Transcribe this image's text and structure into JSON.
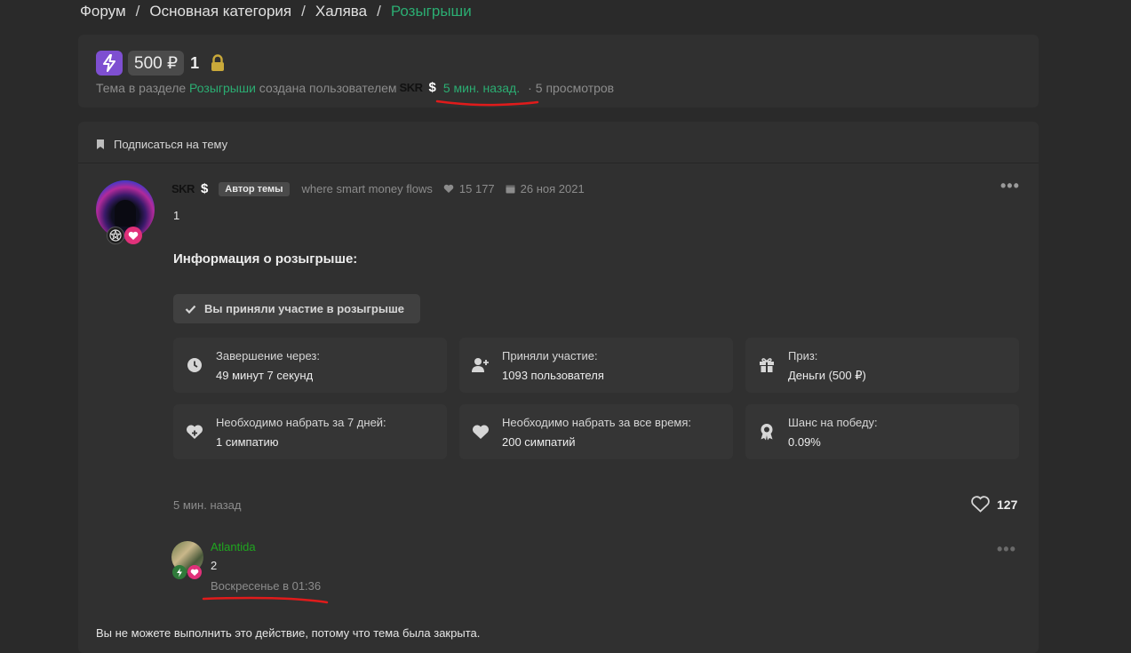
{
  "breadcrumb": {
    "items": [
      "Форум",
      "Основная категория",
      "Халява"
    ],
    "separator": "/",
    "current": "Розыгрыши"
  },
  "thread": {
    "price": "500 ₽",
    "title": "1",
    "meta": {
      "prefix": "Тема в разделе",
      "section": "Розыгрыши",
      "middle": "создана пользователем",
      "author": "SKR",
      "author_suffix": "$",
      "time": "5 мин. назад.",
      "views": "5 просмотров",
      "dot": "·"
    }
  },
  "subscribe": {
    "label": "Подписаться на тему"
  },
  "post": {
    "author": "SKR",
    "author_suffix": "$",
    "author_badge": "Автор темы",
    "tagline": "where smart money flows",
    "likes_count": "15 177",
    "join_date": "26 ноя 2021",
    "menu": "•••",
    "text": "1",
    "info_title": "Информация о розыгрыше:",
    "joined_label": "Вы приняли участие в розыгрыше",
    "cards": [
      {
        "label": "Завершение через:",
        "value": "49 минут 7 секунд",
        "icon": "clock-icon"
      },
      {
        "label": "Приняли участие:",
        "value": "1093 пользователя",
        "icon": "user-plus-icon"
      },
      {
        "label": "Приз:",
        "value": "Деньги (500 ₽)",
        "icon": "gift-icon"
      },
      {
        "label": "Необходимо набрать за 7 дней:",
        "value": "1 симпатию",
        "icon": "heart-plus-icon"
      },
      {
        "label": "Необходимо набрать за все время:",
        "value": "200 симпатий",
        "icon": "heart-icon"
      },
      {
        "label": "Шанс на победу:",
        "value": "0.09%",
        "icon": "award-icon"
      }
    ],
    "time": "5 мин. назад",
    "reactions": "127"
  },
  "reply": {
    "author": "Atlantida",
    "text": "2",
    "time": "Воскресенье в 01:36",
    "menu": "•••"
  },
  "closed_message": "Вы не можете выполнить это действие, потому что тема была закрыта.",
  "colors": {
    "accent_green": "#2bad72",
    "reply_name_green": "#1fa61f",
    "bolt_purple": "#7e4fd1",
    "lock_gold": "#c9a93a",
    "annotation_red": "#e01b1b"
  }
}
